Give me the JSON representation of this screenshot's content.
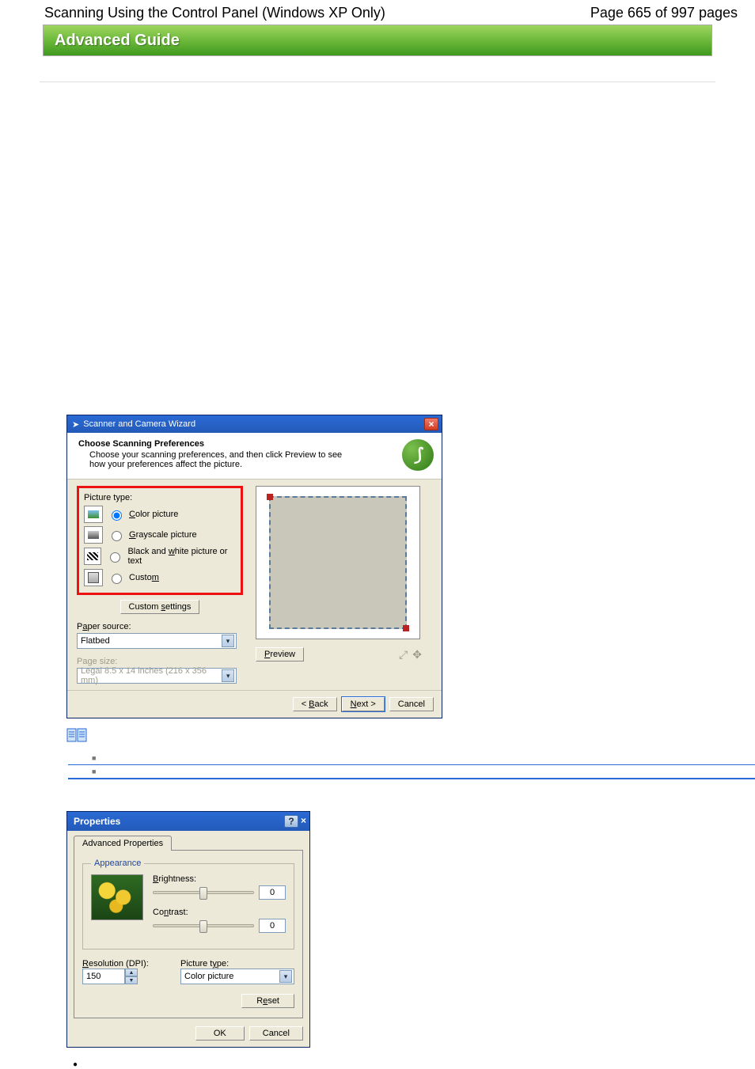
{
  "page_header": {
    "left": "Scanning Using the Control Panel (Windows XP Only)",
    "right": "Page 665 of 997 pages"
  },
  "banner": {
    "title": "Advanced Guide"
  },
  "wizard": {
    "title": "Scanner and Camera Wizard",
    "header_title": "Choose Scanning Preferences",
    "header_sub": "Choose your scanning preferences, and then click Preview to see how your preferences affect the picture.",
    "picture_type_label": "Picture type:",
    "options": {
      "color": "Color picture",
      "grayscale": "Grayscale picture",
      "bw": "Black and white picture or text",
      "custom": "Custom"
    },
    "custom_settings_btn": "Custom settings",
    "paper_source_label": "Paper source:",
    "paper_source_value": "Flatbed",
    "page_size_label": "Page size:",
    "page_size_value": "Legal 8.5 x 14 inches (216 x 356 mm)",
    "preview_btn": "Preview",
    "footer": {
      "back": "< Back",
      "next": "Next >",
      "cancel": "Cancel"
    }
  },
  "props": {
    "title": "Properties",
    "tab": "Advanced Properties",
    "legend": "Appearance",
    "brightness_label": "Brightness:",
    "brightness_value": "0",
    "contrast_label": "Contrast:",
    "contrast_value": "0",
    "resolution_label": "Resolution (DPI):",
    "resolution_value": "150",
    "picture_type_label": "Picture type:",
    "picture_type_value": "Color picture",
    "reset": "Reset",
    "ok": "OK",
    "cancel": "Cancel"
  }
}
